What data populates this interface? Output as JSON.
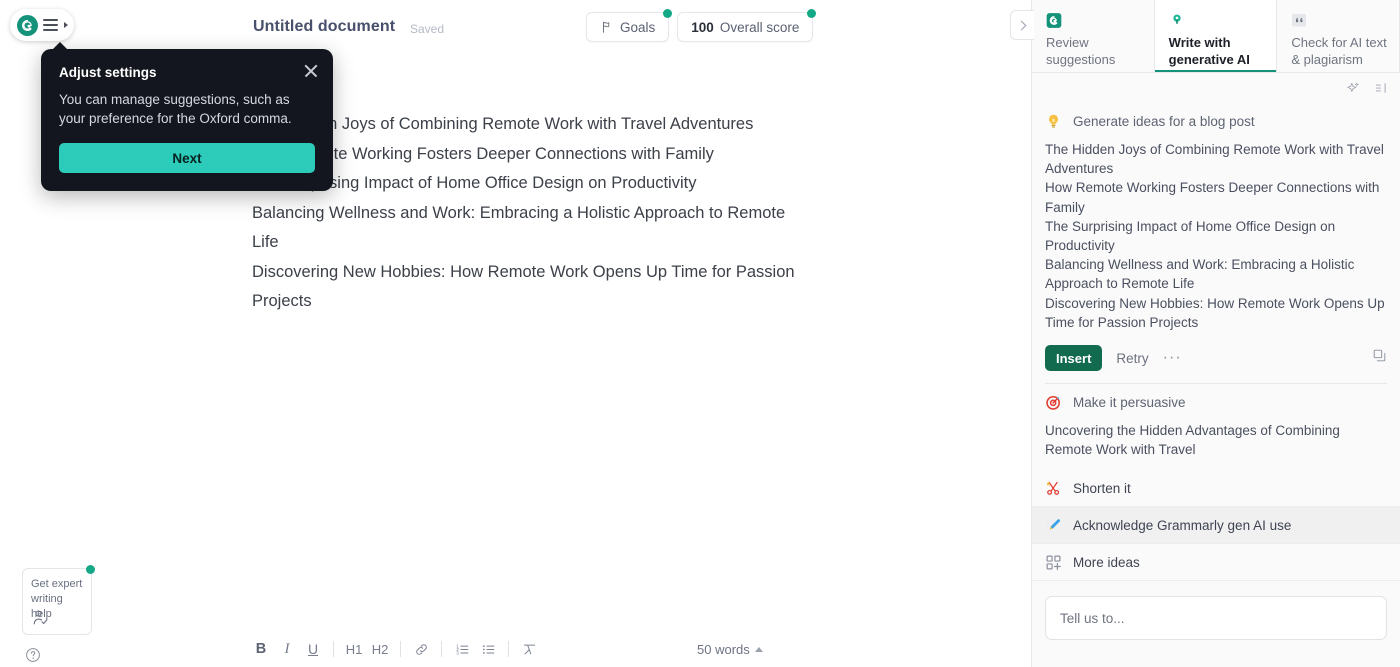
{
  "app": {
    "logo_icon": "grammarly-g-icon",
    "menu_icon": "hamburger-menu-icon",
    "title": "Untitled document",
    "save_status": "Saved"
  },
  "header": {
    "goals": {
      "label": "Goals",
      "icon": "goal-flag-icon",
      "has_dot": true
    },
    "score": {
      "value": "100",
      "label": "Overall score",
      "has_dot": true
    }
  },
  "coachmark": {
    "title": "Adjust settings",
    "body": "You can manage suggestions, such as your preference for the Oxford comma.",
    "button": "Next",
    "close_icon": "close-icon"
  },
  "document": {
    "lines": [
      "The Hidden Joys of Combining Remote Work with Travel Adventures",
      "How Remote Working Fosters Deeper Connections with Family",
      "The Surprising Impact of Home Office Design on Productivity",
      "Balancing Wellness and Work: Embracing a Holistic Approach to Remote Life",
      "Discovering New Hobbies: How Remote Work Opens Up Time for Passion Projects"
    ]
  },
  "expert_card": {
    "line1": "Get expert",
    "line2": "writing help",
    "icon": "person-check-icon",
    "has_dot": true,
    "help_icon": "question-mark-icon"
  },
  "toolbar": {
    "bold": "B",
    "italic": "I",
    "underline": "U",
    "h1": "H1",
    "h2": "H2",
    "link_icon": "link-icon",
    "ordered_list_icon": "numbered-list-icon",
    "bullet_list_icon": "bullet-list-icon",
    "clear_format_icon": "clear-formatting-icon",
    "word_count": "50 words"
  },
  "sidebar": {
    "collapse_icon": "chevron-right-icon",
    "tabs": [
      {
        "label": "Review suggestions",
        "icon": "grammarly-g-icon",
        "active": false
      },
      {
        "label": "Write with generative AI",
        "icon": "lightbulb-pin-icon",
        "active": true
      },
      {
        "label": "Check for AI text & plagiarism",
        "icon": "quote-marks-icon",
        "active": false
      }
    ],
    "tools": [
      {
        "icon": "sparkle-icon"
      },
      {
        "icon": "collapse-panel-icon"
      }
    ],
    "cards": [
      {
        "icon": "lightbulb-icon",
        "title": "Generate ideas for a blog post",
        "suggestions": [
          "The Hidden Joys of Combining Remote Work with Travel Adventures",
          "How Remote Working Fosters Deeper Connections with Family",
          "The Surprising Impact of Home Office Design on Productivity",
          "Balancing Wellness and Work: Embracing a Holistic Approach to Remote Life",
          "Discovering New Hobbies: How Remote Work Opens Up Time for Passion Projects"
        ],
        "insert_label": "Insert",
        "retry_label": "Retry",
        "more_label": "···",
        "copy_icon": "copy-icon"
      },
      {
        "icon": "target-icon",
        "title": "Make it persuasive",
        "suggestions": [
          "Uncovering the Hidden Advantages of Combining Remote Work with Travel"
        ]
      }
    ],
    "actions": [
      {
        "icon": "scissors-icon",
        "label": "Shorten it",
        "highlighted": false
      },
      {
        "icon": "pen-icon",
        "label": "Acknowledge Grammarly gen AI use",
        "highlighted": true
      },
      {
        "icon": "grid-plus-icon",
        "label": "More ideas",
        "highlighted": false
      }
    ],
    "composer_placeholder": "Tell us to..."
  },
  "colors": {
    "teal": "#2ccbba",
    "grammarly_green": "#15937a",
    "insert_green": "#136b4f",
    "status_dot": "#15a886",
    "coach_bg": "#14161f"
  }
}
